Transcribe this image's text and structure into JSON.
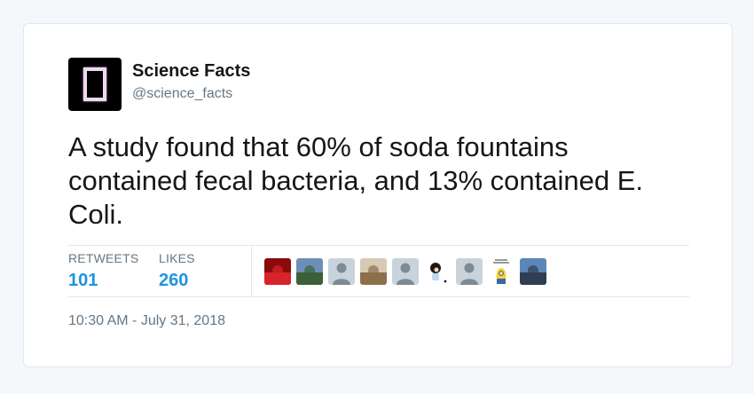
{
  "author": {
    "display_name": "Science Facts",
    "handle": "@science_facts",
    "avatar_icon": "framed-rectangle-logo"
  },
  "tweet": {
    "text": "A study found that 60% of soda fountains contained fecal bacteria, and 13% contained E. Coli.",
    "timestamp": "10:30 AM - July 31, 2018"
  },
  "stats": {
    "retweets_label": "RETWEETS",
    "retweets_count": "101",
    "likes_label": "LIKES",
    "likes_count": "260"
  },
  "likers": [
    {
      "kind": "photo",
      "colors": [
        "#8b0a0a",
        "#d8232a"
      ]
    },
    {
      "kind": "photo",
      "colors": [
        "#6d8fb5",
        "#3c5f3a"
      ]
    },
    {
      "kind": "default",
      "colors": [
        "#c9d3dc",
        "#7c8b98"
      ]
    },
    {
      "kind": "photo",
      "colors": [
        "#d7c9b4",
        "#8e6f4c"
      ]
    },
    {
      "kind": "default",
      "colors": [
        "#c9d3dc",
        "#7c8b98"
      ]
    },
    {
      "kind": "cartoon",
      "colors": [
        "#ffffff",
        "#1a1a1a"
      ]
    },
    {
      "kind": "default",
      "colors": [
        "#c9d3dc",
        "#7c8b98"
      ]
    },
    {
      "kind": "minion",
      "colors": [
        "#ffffff",
        "#f5d432"
      ]
    },
    {
      "kind": "photo",
      "colors": [
        "#5a86b8",
        "#2f3e52"
      ]
    }
  ],
  "colors": {
    "accent": "#1b95e0",
    "text_primary": "#14171a",
    "text_secondary": "#657786",
    "border": "#e1e8ed"
  }
}
